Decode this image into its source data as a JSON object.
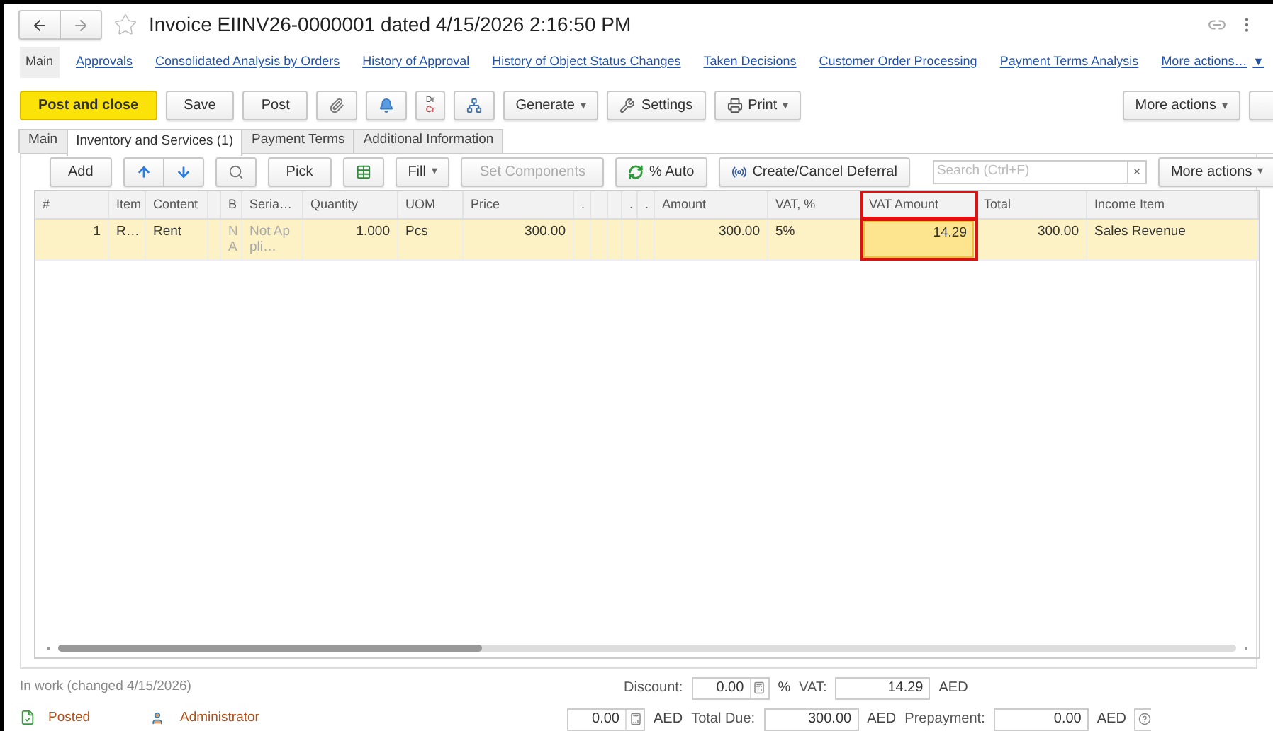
{
  "window": {
    "title": "Invoice EIINV26-0000001 dated 4/15/2026 2:16:50 PM"
  },
  "nav": [
    {
      "label": "Main",
      "selected": true,
      "kind": "link"
    },
    {
      "label": "Approvals",
      "selected": false,
      "kind": "link"
    },
    {
      "label": "Consolidated Analysis by Orders",
      "selected": false,
      "kind": "link"
    },
    {
      "label": "History of Approval",
      "selected": false,
      "kind": "link"
    },
    {
      "label": "History of Object Status Changes",
      "selected": false,
      "kind": "link"
    },
    {
      "label": "Taken Decisions",
      "selected": false,
      "kind": "link"
    },
    {
      "label": "Customer Order Processing",
      "selected": false,
      "kind": "link"
    },
    {
      "label": "Payment Terms Analysis",
      "selected": false,
      "kind": "link"
    },
    {
      "label": "More actions…",
      "selected": false,
      "kind": "menu",
      "caret": "▼"
    }
  ],
  "toolbar": [
    {
      "kind": "primary",
      "label": "Post and close"
    },
    {
      "kind": "button",
      "label": "Save"
    },
    {
      "kind": "button",
      "label": "Post"
    },
    {
      "kind": "attach"
    },
    {
      "kind": "notify"
    },
    {
      "kind": "drcr",
      "top": "Dr",
      "bottom": "Cr"
    },
    {
      "kind": "structure"
    },
    {
      "kind": "menu",
      "label": "Generate",
      "caret": "▾"
    },
    {
      "kind": "settings",
      "label": "Settings"
    },
    {
      "kind": "print",
      "label": "Print",
      "caret": "▾"
    }
  ],
  "toolbar_right": {
    "label": "More actions",
    "caret": "▾"
  },
  "tabs": [
    {
      "label": "Main",
      "selected": false
    },
    {
      "label": "Inventory and Services (1)",
      "selected": true
    },
    {
      "label": "Payment Terms",
      "selected": false
    },
    {
      "label": "Additional Information",
      "selected": false
    }
  ],
  "subtoolbar": [
    {
      "kind": "button",
      "label": "Add",
      "disabled": false
    },
    {
      "kind": "updown"
    },
    {
      "kind": "find"
    },
    {
      "kind": "button",
      "label": "Pick",
      "disabled": false
    },
    {
      "kind": "sheet"
    },
    {
      "kind": "menu",
      "label": "Fill",
      "disabled": false,
      "caret": "▾"
    },
    {
      "kind": "button",
      "label": "Set Components",
      "disabled": true
    },
    {
      "kind": "refresh",
      "label": "% Auto",
      "disabled": false
    },
    {
      "kind": "deferral",
      "label": "Create/Cancel Deferral",
      "disabled": false
    }
  ],
  "search": {
    "placeholder": "Search (Ctrl+F)",
    "clear": "×"
  },
  "subtoolbar_right": {
    "label": "More actions",
    "caret": "▾"
  },
  "table": {
    "columns": [
      {
        "kind": "text",
        "label": "#"
      },
      {
        "kind": "text",
        "label": "Item"
      },
      {
        "kind": "text",
        "label": "Content"
      },
      {
        "kind": "spacer"
      },
      {
        "kind": "text",
        "label": "B"
      },
      {
        "kind": "text",
        "label": "Seria…"
      },
      {
        "kind": "text",
        "label": "Quantity"
      },
      {
        "kind": "text",
        "label": "UOM"
      },
      {
        "kind": "text",
        "label": "Price"
      },
      {
        "kind": "text",
        "label": "."
      },
      {
        "kind": "spacer"
      },
      {
        "kind": "spacer"
      },
      {
        "kind": "text",
        "label": "."
      },
      {
        "kind": "text",
        "label": "."
      },
      {
        "kind": "text",
        "label": "Amount"
      },
      {
        "kind": "text",
        "label": "VAT, %"
      },
      {
        "kind": "text",
        "label": "VAT Amount",
        "highlighted": true
      },
      {
        "kind": "text",
        "label": "Total"
      },
      {
        "kind": "text",
        "label": "Income Item"
      }
    ],
    "rows": [
      {
        "selected": true,
        "cells": [
          {
            "text": "1",
            "numeric": true
          },
          {
            "text": "R…"
          },
          {
            "text": "Rent"
          },
          null,
          {
            "text": "NA",
            "muted": true
          },
          {
            "text": "Not Appli…",
            "muted": true
          },
          {
            "text": "1.000",
            "numeric": true
          },
          {
            "text": "Pcs"
          },
          {
            "text": "300.00",
            "numeric": true
          },
          null,
          null,
          null,
          null,
          null,
          {
            "text": "300.00",
            "numeric": true
          },
          {
            "text": "5%"
          },
          {
            "text": "14.29",
            "numeric": true,
            "focused": true
          },
          {
            "text": "300.00",
            "numeric": true
          },
          {
            "text": "Sales Revenue"
          }
        ]
      }
    ]
  },
  "footer": {
    "status": "In work (changed 4/15/2026)",
    "posted": "Posted",
    "author": "Administrator"
  },
  "summary": [
    [
      {
        "kind": "label",
        "text": "Discount:"
      },
      {
        "kind": "calc",
        "value": "0.00"
      },
      {
        "kind": "unit",
        "text": "%"
      },
      {
        "kind": "label",
        "text": "VAT:"
      },
      {
        "kind": "field",
        "value": "14.29"
      },
      {
        "kind": "unit",
        "text": "AED"
      }
    ],
    [
      {
        "kind": "calc",
        "value": "0.00"
      },
      {
        "kind": "unit",
        "text": "AED"
      },
      {
        "kind": "label",
        "text": "Total Due:"
      },
      {
        "kind": "field",
        "value": "300.00"
      },
      {
        "kind": "unit",
        "text": "AED"
      },
      {
        "kind": "label",
        "text": "Prepayment:"
      },
      {
        "kind": "field",
        "value": "0.00"
      },
      {
        "kind": "unit",
        "text": "AED"
      },
      {
        "kind": "cut"
      }
    ]
  ]
}
